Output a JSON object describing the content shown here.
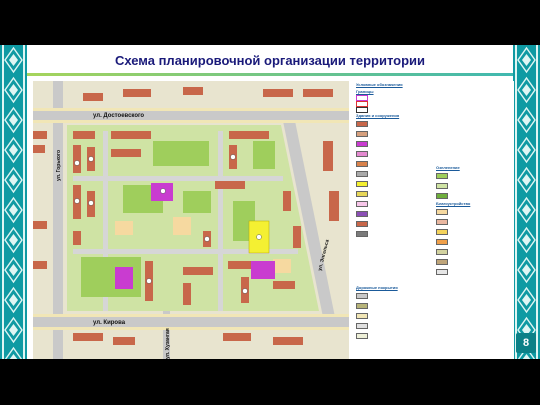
{
  "title": "Схема планировочной организации территории",
  "page_number": "8",
  "colors": {
    "frame": "#0f9aa3",
    "title": "#1a1a7a",
    "building_existing": "#c8674a",
    "building_new": "#c93cd0",
    "school": "#f4f032",
    "lawn": "#a9d26b",
    "road": "#c9c9c9",
    "sidewalk": "#f1e6b6"
  },
  "streets": {
    "dostoevsky": "ул. Достоевского",
    "kirova": "ул. Кирова",
    "gorky": "ул. Горького",
    "khuzangaya": "ул. Хузангая",
    "engels": "ул. Энгельса"
  },
  "legend": {
    "heading": "Условные обозначения",
    "sections": {
      "borders": "Границы",
      "buildings": "Здания и сооружения",
      "coverings": "Дорожные покрытия",
      "greening": "Озеленение",
      "improvement": "Благоустройство"
    }
  }
}
